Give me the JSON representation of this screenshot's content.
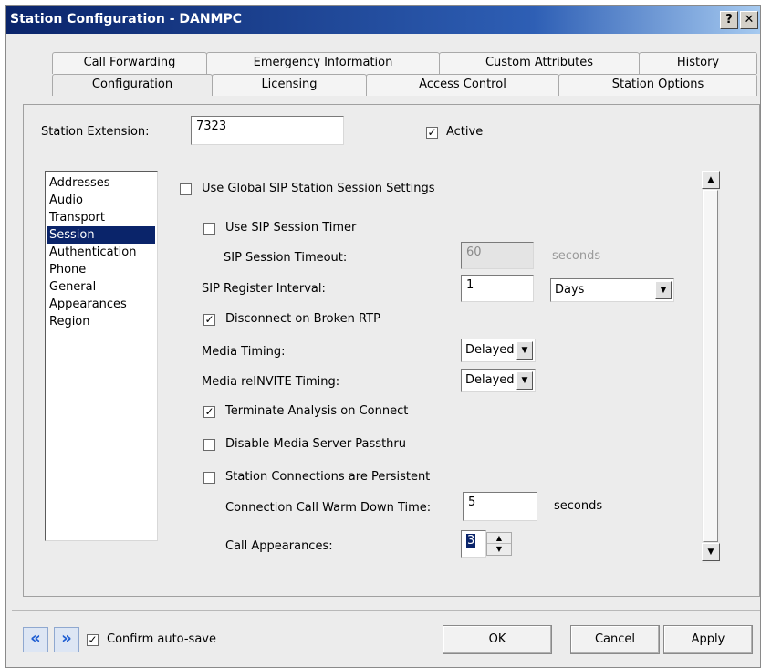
{
  "window": {
    "title": "Station Configuration - DANMPC",
    "help_label": "?",
    "close_label": "✕"
  },
  "tabs_back": [
    "Call Forwarding",
    "Emergency Information",
    "Custom Attributes",
    "History"
  ],
  "tabs_front": [
    "Configuration",
    "Licensing",
    "Access Control",
    "Station Options"
  ],
  "active_tab": "Configuration",
  "station": {
    "extension_label": "Station Extension:",
    "extension_value": "7323",
    "active_label": "Active",
    "active_checked": true
  },
  "nav_list": {
    "items": [
      "Addresses",
      "Audio",
      "Transport",
      "Session",
      "Authentication",
      "Phone",
      "General",
      "Appearances",
      "Region"
    ],
    "selected": "Session"
  },
  "session": {
    "use_global_label": "Use Global SIP Station Session Settings",
    "use_global_checked": false,
    "use_timer_label": "Use SIP Session Timer",
    "use_timer_checked": false,
    "timeout_label": "SIP Session Timeout:",
    "timeout_value": "60",
    "timeout_unit": "seconds",
    "register_label": "SIP Register Interval:",
    "register_value": "1",
    "register_unit": "Days",
    "disconnect_label": "Disconnect on Broken RTP",
    "disconnect_checked": true,
    "media_timing_label": "Media Timing:",
    "media_timing_value": "Delayed",
    "media_reinvite_label": "Media reINVITE Timing:",
    "media_reinvite_value": "Delayed",
    "terminate_label": "Terminate Analysis on Connect",
    "terminate_checked": true,
    "disable_media_label": "Disable Media Server Passthru",
    "disable_media_checked": false,
    "persistent_label": "Station Connections are Persistent",
    "persistent_checked": false,
    "warm_down_label": "Connection Call Warm Down Time:",
    "warm_down_value": "5",
    "warm_down_unit": "seconds",
    "appearances_label": "Call Appearances:",
    "appearances_value": "3"
  },
  "footer": {
    "prev_label": "«",
    "next_label": "»",
    "confirm_label": "Confirm auto-save",
    "confirm_checked": true,
    "ok_label": "OK",
    "cancel_label": "Cancel",
    "apply_label": "Apply"
  },
  "colors": {
    "titlebar": "#0a246a",
    "selection": "#0a246a",
    "nav_arrow": "#1f5ed2"
  }
}
